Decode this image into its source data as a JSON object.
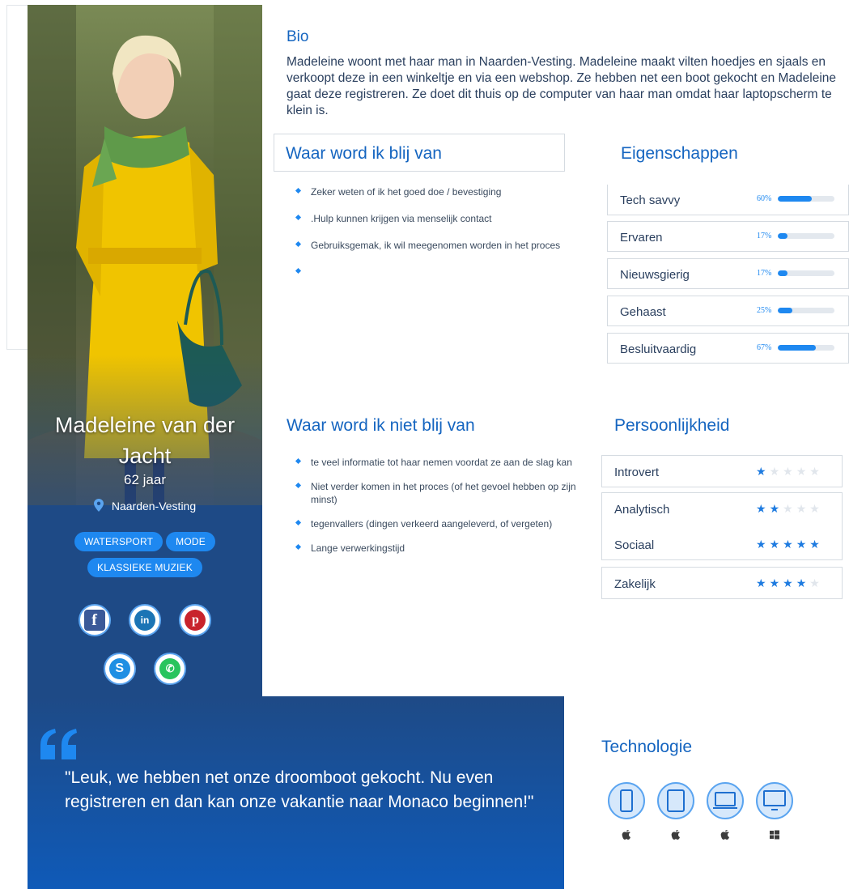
{
  "profile": {
    "name": "Madeleine van der Jacht",
    "age": "62 jaar",
    "location": "Naarden-Vesting",
    "tags": [
      "WATERSPORT",
      "MODE",
      "KLASSIEKE MUZIEK"
    ],
    "socials": [
      "facebook-icon",
      "linkedin-icon",
      "pinterest-icon",
      "skype-icon",
      "whatsapp-icon"
    ]
  },
  "bio": {
    "title": "Bio",
    "text": "Madeleine woont met haar man in Naarden-Vesting. Madeleine maakt vilten hoedjes en sjaals en verkoopt deze in een winkeltje en via een webshop. Ze hebben net een boot gekocht en Madeleine gaat deze registreren. Ze doet dit thuis op de computer van haar man omdat haar laptopscherm te klein is."
  },
  "happy": {
    "title": "Waar word ik blij van",
    "items": [
      "Zeker weten of ik het goed doe / bevestiging",
      ".Hulp kunnen krijgen via menselijk contact",
      "Gebruiksgemak, ik wil meegenomen worden in het proces",
      ""
    ]
  },
  "unhappy": {
    "title": "Waar word ik niet blij van",
    "items": [
      "te veel informatie tot haar nemen voordat ze aan de slag kan",
      "Niet verder komen in het proces (of het gevoel hebben op zijn minst)",
      "tegenvallers (dingen verkeerd aangeleverd, of vergeten)",
      "Lange verwerkingstijd"
    ]
  },
  "traits": {
    "title": "Eigenschappen",
    "items": [
      {
        "label": "Tech savvy",
        "pct": "60%",
        "value": 0.6
      },
      {
        "label": "Ervaren",
        "pct": "17%",
        "value": 0.17
      },
      {
        "label": "Nieuwsgierig",
        "pct": "17%",
        "value": 0.17
      },
      {
        "label": "Gehaast",
        "pct": "25%",
        "value": 0.25
      },
      {
        "label": "Besluitvaardig",
        "pct": "67%",
        "value": 0.67
      }
    ]
  },
  "personality": {
    "title": "Persoonlijkheid",
    "items": [
      {
        "label": "Introvert",
        "stars": 1
      },
      {
        "label": "Analytisch",
        "stars": 2
      },
      {
        "label": "Sociaal",
        "stars": 5
      },
      {
        "label": "Zakelijk",
        "stars": 4
      }
    ],
    "max_stars": 5
  },
  "quote": {
    "text": "\"Leuk, we hebben net onze droomboot gekocht. Nu even registreren en dan kan onze vakantie naar Monaco beginnen!\""
  },
  "technology": {
    "title": "Technologie",
    "devices": [
      {
        "device": "smartphone-icon",
        "os": "apple-icon"
      },
      {
        "device": "tablet-icon",
        "os": "apple-icon"
      },
      {
        "device": "laptop-icon",
        "os": "apple-icon"
      },
      {
        "device": "desktop-icon",
        "os": "windows-icon"
      }
    ]
  },
  "colors": {
    "accent": "#1e88f0",
    "heading": "#1565c0",
    "profile_bg": "#1e4a86",
    "star_off": "#e1e6ec"
  }
}
